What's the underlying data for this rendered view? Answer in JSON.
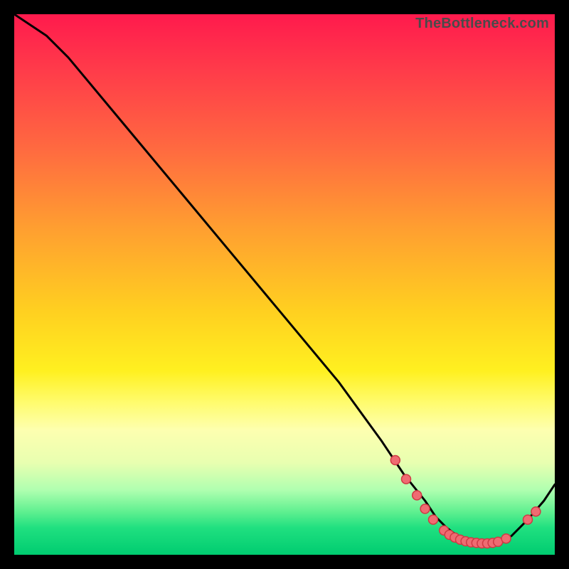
{
  "watermark": "TheBottleneck.com",
  "chart_data": {
    "type": "line",
    "title": "",
    "xlabel": "",
    "ylabel": "",
    "xlim": [
      0,
      100
    ],
    "ylim": [
      0,
      100
    ],
    "series": [
      {
        "name": "curve",
        "x": [
          0,
          6,
          10,
          20,
          30,
          40,
          50,
          60,
          68,
          72,
          76,
          78,
          80,
          82,
          84,
          86,
          88,
          90,
          92,
          95,
          98,
          100
        ],
        "y": [
          100,
          96,
          92,
          80,
          68,
          56,
          44,
          32,
          21,
          15,
          10,
          7,
          5,
          3.5,
          2.5,
          2.0,
          2.0,
          2.2,
          3.5,
          6.5,
          10,
          13
        ]
      }
    ],
    "markers": [
      {
        "x": 70.5,
        "y": 17.5
      },
      {
        "x": 72.5,
        "y": 14.0
      },
      {
        "x": 74.5,
        "y": 11.0
      },
      {
        "x": 76.0,
        "y": 8.5
      },
      {
        "x": 77.5,
        "y": 6.5
      },
      {
        "x": 79.5,
        "y": 4.5
      },
      {
        "x": 80.5,
        "y": 3.7
      },
      {
        "x": 81.5,
        "y": 3.2
      },
      {
        "x": 82.5,
        "y": 2.8
      },
      {
        "x": 83.5,
        "y": 2.5
      },
      {
        "x": 84.5,
        "y": 2.3
      },
      {
        "x": 85.5,
        "y": 2.2
      },
      {
        "x": 86.5,
        "y": 2.1
      },
      {
        "x": 87.5,
        "y": 2.1
      },
      {
        "x": 88.5,
        "y": 2.2
      },
      {
        "x": 89.5,
        "y": 2.4
      },
      {
        "x": 91.0,
        "y": 3.0
      },
      {
        "x": 95.0,
        "y": 6.5
      },
      {
        "x": 96.5,
        "y": 8.0
      }
    ],
    "marker_style": {
      "fill": "#ef6b72",
      "stroke": "#cf3a44",
      "r": 6.5
    }
  }
}
